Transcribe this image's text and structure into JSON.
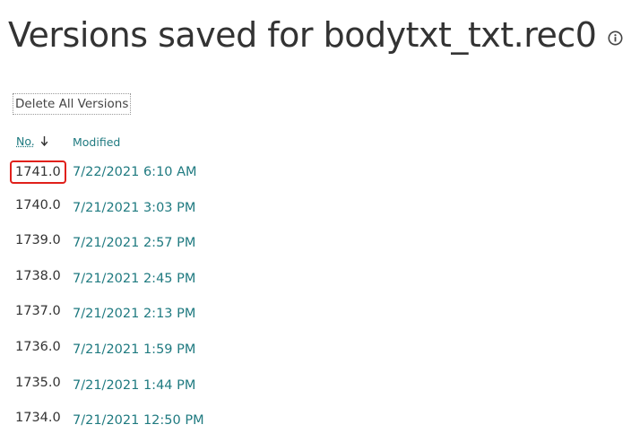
{
  "page": {
    "title": "Versions saved for bodytxt_txt.rec0",
    "info_icon": "info-icon"
  },
  "toolbar": {
    "delete_all_label": "Delete All Versions"
  },
  "table": {
    "columns": {
      "no": "No.",
      "modified": "Modified"
    },
    "sort": {
      "column": "No.",
      "direction": "descending",
      "icon": "arrow-down-icon"
    },
    "rows": [
      {
        "no": "1741.0",
        "modified": "7/22/2021 6:10 AM",
        "highlighted": true
      },
      {
        "no": "1740.0",
        "modified": "7/21/2021 3:03 PM"
      },
      {
        "no": "1739.0",
        "modified": "7/21/2021 2:57 PM"
      },
      {
        "no": "1738.0",
        "modified": "7/21/2021 2:45 PM"
      },
      {
        "no": "1737.0",
        "modified": "7/21/2021 2:13 PM"
      },
      {
        "no": "1736.0",
        "modified": "7/21/2021 1:59 PM"
      },
      {
        "no": "1735.0",
        "modified": "7/21/2021 1:44 PM"
      },
      {
        "no": "1734.0",
        "modified": "7/21/2021 12:50 PM"
      }
    ]
  },
  "colors": {
    "title_text": "#333333",
    "link_teal": "#1f7a80",
    "highlight_red": "#e0201b"
  }
}
